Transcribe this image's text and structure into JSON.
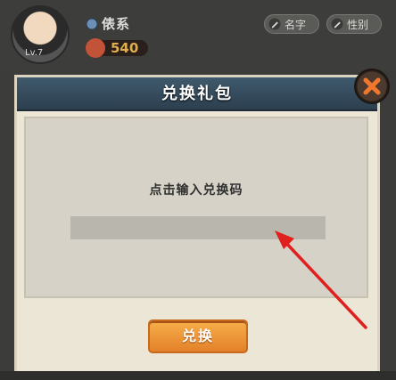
{
  "player": {
    "name": "俵系",
    "level_text": "Lv.7",
    "rank_value": "540"
  },
  "buttons": {
    "name_label": "名字",
    "gender_label": "性别"
  },
  "dialog": {
    "title": "兑换礼包",
    "prompt": "点击输入兑换码",
    "input_value": "",
    "input_placeholder": "",
    "confirm_label": "兑换"
  },
  "colors": {
    "header": "#34495a",
    "confirm": "#f0953a",
    "arrow": "#e0201e",
    "rank_value": "#dfae4f"
  },
  "icons": {
    "close": "close-x-icon",
    "edit_name": "pencil-icon",
    "gender": "gender-icon"
  }
}
